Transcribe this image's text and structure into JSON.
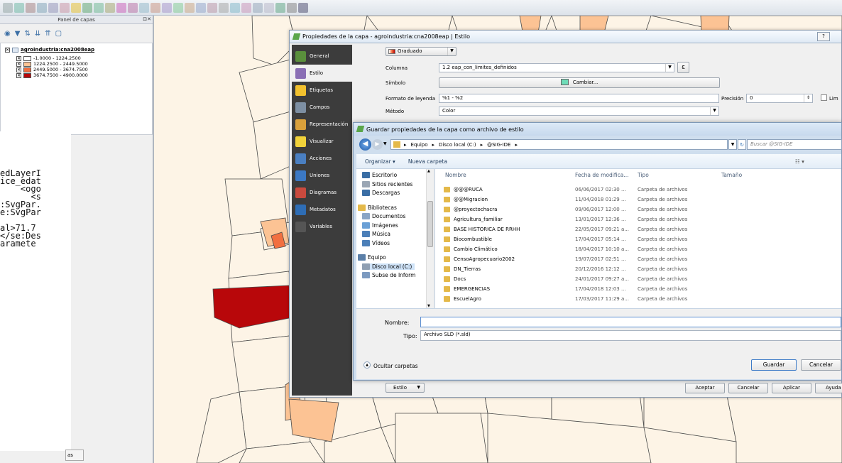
{
  "panel": {
    "title": "Panel de capas",
    "layer_name": "agroindustria:cna2008eap",
    "legend": [
      {
        "label": "-1.0000 - 1224.2500",
        "color": "#ffffff"
      },
      {
        "label": "1224.2500 - 2449.5000",
        "color": "#fcc394"
      },
      {
        "label": "2449.5000 - 3674.7500",
        "color": "#f26f40"
      },
      {
        "label": "3674.7500 - 4900.0000",
        "color": "#b8070a"
      }
    ],
    "bottom_tab": "as"
  },
  "xml_fragments": [
    "edLayerI",
    "ice_edat",
    "    <ogo",
    "      <s",
    ":SvgPar.",
    "e:SvgPar",
    "",
    "al>71.7",
    "</se:Des",
    "aramete"
  ],
  "props_dialog": {
    "title": "Propiedades de la capa - agroindustria:cna2008eap | Estilo",
    "help": "?",
    "nav": [
      {
        "label": "General",
        "color": "#5a8f3c"
      },
      {
        "label": "Estilo",
        "color": "#8a6fb5"
      },
      {
        "label": "Etiquetas",
        "color": "#f2c12e"
      },
      {
        "label": "Campos",
        "color": "#7d8fa3"
      },
      {
        "label": "Representación",
        "color": "#d9a03b"
      },
      {
        "label": "Visualizar",
        "color": "#f1d23a"
      },
      {
        "label": "Acciones",
        "color": "#4a7fc1"
      },
      {
        "label": "Uniones",
        "color": "#3b78c4"
      },
      {
        "label": "Diagramas",
        "color": "#c94a3e"
      },
      {
        "label": "Metadatos",
        "color": "#2e6db5"
      },
      {
        "label": "Variables",
        "color": "#555555"
      }
    ],
    "renderer": "Graduado",
    "column_label": "Columna",
    "column_value": "1.2 eap_con_limites_definidos",
    "epsilon": "ε",
    "symbol_label": "Símbolo",
    "symbol_button": "Cambiar...",
    "legend_format_label": "Formato de leyenda",
    "legend_format_value": "%1 - %2",
    "precision_label": "Precisión",
    "precision_value": "0",
    "trim_label": "Lim",
    "method_label": "Método",
    "method_value": "Color",
    "style_button": "Estilo",
    "accept": "Aceptar",
    "cancel": "Cancelar",
    "apply": "Aplicar",
    "help_button": "Ayuda"
  },
  "save_dialog": {
    "title": "Guardar propiedades de la capa como archivo de estilo",
    "breadcrumb": [
      "Equipo",
      "Disco local (C:)",
      "@SIG-IDE"
    ],
    "search_placeholder": "Buscar @SIG-IDE",
    "organize": "Organizar ▾",
    "new_folder": "Nueva carpeta",
    "sidebar": [
      {
        "label": "Escritorio",
        "color": "#3a6ea5"
      },
      {
        "label": "Sitios recientes",
        "color": "#9aa6b4"
      },
      {
        "label": "Descargas",
        "color": "#3a6ea5"
      },
      {
        "label": "",
        "color": ""
      },
      {
        "label": "Bibliotecas",
        "color": "#e4b94a"
      },
      {
        "label": "Documentos",
        "color": "#8aa5c6"
      },
      {
        "label": "Imágenes",
        "color": "#6aa0d6"
      },
      {
        "label": "Música",
        "color": "#4c7fb8"
      },
      {
        "label": "Vídeos",
        "color": "#4c7fb8"
      },
      {
        "label": "",
        "color": ""
      },
      {
        "label": "Equipo",
        "color": "#5b7fa8"
      },
      {
        "label": "Disco local (C:)",
        "color": "#8f9fb2"
      },
      {
        "label": "Subse de Inform",
        "color": "#7c9ac0"
      }
    ],
    "columns": {
      "name": "Nombre",
      "date": "Fecha de modifica...",
      "type": "Tipo",
      "size": "Tamaño"
    },
    "files": [
      {
        "name": "@@@RUCA",
        "date": "06/06/2017 02:30 ...",
        "type": "Carpeta de archivos"
      },
      {
        "name": "@@Migracion",
        "date": "11/04/2018 01:29 ...",
        "type": "Carpeta de archivos"
      },
      {
        "name": "@proyectochacra",
        "date": "09/06/2017 12:00 ...",
        "type": "Carpeta de archivos"
      },
      {
        "name": "Agricultura_familiar",
        "date": "13/01/2017 12:36 ...",
        "type": "Carpeta de archivos"
      },
      {
        "name": "BASE HISTORICA DE RRHH",
        "date": "22/05/2017 09:21 a...",
        "type": "Carpeta de archivos"
      },
      {
        "name": "Biocombustible",
        "date": "17/04/2017 05:14 ...",
        "type": "Carpeta de archivos"
      },
      {
        "name": "Cambio Climático",
        "date": "18/04/2017 10:10 a...",
        "type": "Carpeta de archivos"
      },
      {
        "name": "CensoAgropecuario2002",
        "date": "19/07/2017 02:51 ...",
        "type": "Carpeta de archivos"
      },
      {
        "name": "DN_Tierras",
        "date": "20/12/2016 12:12 ...",
        "type": "Carpeta de archivos"
      },
      {
        "name": "Docs",
        "date": "24/01/2017 09:27 a...",
        "type": "Carpeta de archivos"
      },
      {
        "name": "EMERGENCIAS",
        "date": "17/04/2018 12:03 ...",
        "type": "Carpeta de archivos"
      },
      {
        "name": "EscuelAgro",
        "date": "17/03/2017 11:29 a...",
        "type": "Carpeta de archivos"
      }
    ],
    "filename_label": "Nombre:",
    "filename_value": "",
    "type_label": "Tipo:",
    "type_value": "Archivo SLD (*.sld)",
    "hide_folders": "Ocultar carpetas",
    "save": "Guardar",
    "cancel": "Cancelar"
  },
  "map_colors": {
    "base": "#fdf4e6",
    "light": "#fcc394",
    "mid": "#f26f40",
    "dark": "#b8070a",
    "line": "#4a4a4a"
  }
}
